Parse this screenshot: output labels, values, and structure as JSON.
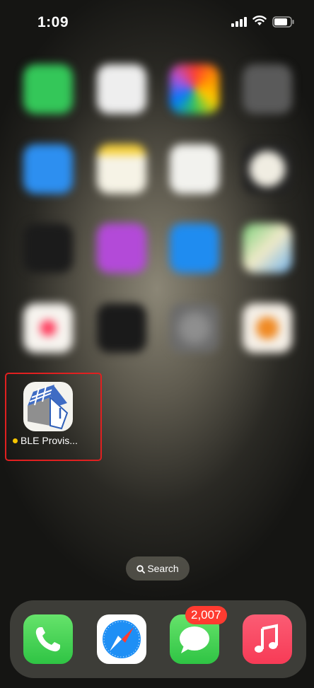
{
  "status_bar": {
    "time": "1:09"
  },
  "home_app": {
    "label": "BLE Provis...",
    "has_update_dot": true
  },
  "search": {
    "label": "Search"
  },
  "dock": {
    "apps": [
      "Phone",
      "Safari",
      "Messages",
      "Music"
    ],
    "messages_badge": "2,007"
  },
  "colors": {
    "highlight_border": "#e02020",
    "badge": "#ff3b30",
    "new_dot": "#f5c400"
  }
}
